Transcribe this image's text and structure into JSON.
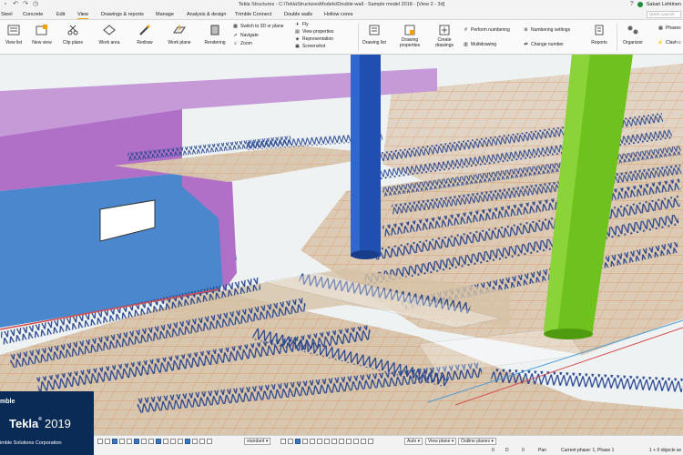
{
  "window": {
    "title": "Tekla Structures - C:\\TeklaStructuresModels\\Double-wall - Sample model 2018 - [View 2 - 3d]",
    "user_name": "Sakari Lehtinen",
    "help_symbol": "?"
  },
  "menu": {
    "tabs": [
      "Steel",
      "Concrete",
      "Edit",
      "View",
      "Drawings & reports",
      "Manage",
      "Analysis & design",
      "Trimble Connect",
      "Double walls",
      "Hollow cores"
    ],
    "active_tab": "View",
    "search_placeholder": "Quick Launch"
  },
  "ribbon": {
    "view_list": "View list",
    "new_view": "New view",
    "clip_plane": "Clip plane",
    "work_area": "Work area",
    "redraw": "Redraw",
    "work_plane": "Work plane",
    "rendering": "Rendering",
    "switch_3d": "Switch to 3D or plane",
    "navigate": "Navigate",
    "zoom": "Zoom",
    "fly": "Fly",
    "view_properties": "View properties",
    "representation": "Representation",
    "screenshot": "Screenshot",
    "drawing_list": "Drawing list",
    "drawing_properties": "Drawing properties",
    "create_drawings": "Create drawings",
    "perform_numbering": "Perform numbering",
    "multidrawing": "Multidrawing",
    "numbering_settings": "Numbering settings",
    "change_number": "Change number",
    "reports": "Reports",
    "organizer": "Organizer",
    "phases": "Phases",
    "clash_check": "Clash c"
  },
  "brand": {
    "trimble": "mble",
    "tekla": "Tekla",
    "reg": "®",
    "year": "2019",
    "corp": "imble Solutions Corporation"
  },
  "statusbar": {
    "select_standard": "standard",
    "select_auto": "Auto",
    "select_view_plane": "View plane",
    "select_outline_planes": "Outline planes",
    "readout_1": "0",
    "readout_2": "D",
    "readout_3": "0",
    "pan": "Pan",
    "current_phase": "Current phase: 1, Phase 1",
    "objects": "1 + 0 objects se"
  },
  "colors": {
    "accent": "#f4a100",
    "brand_blue": "#0a2b55",
    "blue_column": "#1f4fb0",
    "green_column": "#6fc21e",
    "wall": "#b070c8",
    "slab": "#d8c6ae",
    "rebar": "#27468f",
    "mesh": "#d9905a"
  }
}
